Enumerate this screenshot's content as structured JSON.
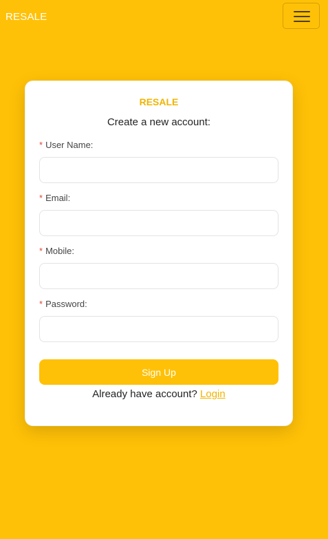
{
  "navbar": {
    "brand": "RESALE",
    "toggle_icon": "hamburger-menu-icon"
  },
  "card": {
    "brand": "RESALE",
    "subtitle": "Create a new account:",
    "required_mark": "*",
    "fields": [
      {
        "label": "User Name:",
        "value": "",
        "placeholder": ""
      },
      {
        "label": "Email:",
        "value": "",
        "placeholder": ""
      },
      {
        "label": "Mobile:",
        "value": "",
        "placeholder": ""
      },
      {
        "label": "Password:",
        "value": "",
        "placeholder": ""
      }
    ],
    "signup_label": "Sign Up",
    "footer_text": "Already have account?",
    "login_label": "Login"
  },
  "colors": {
    "background": "#ffc107",
    "accent": "#f0b400",
    "required": "#e0473b"
  }
}
